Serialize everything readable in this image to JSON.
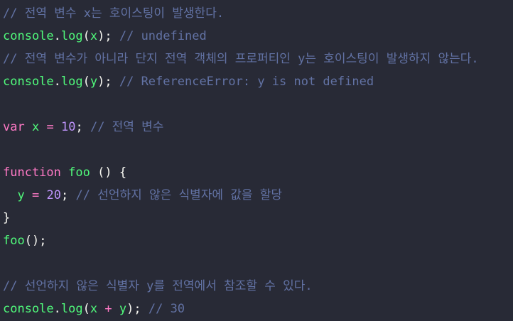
{
  "code": {
    "lines": [
      {
        "comment": "// 전역 변수 x는 호이스팅이 발생한다."
      },
      {
        "obj": "console",
        "dot": ".",
        "method": "log",
        "open": "(",
        "arg": "x",
        "close": ");",
        "space": " ",
        "comment": "// undefined"
      },
      {
        "comment": "// 전역 변수가 아니라 단지 전역 객체의 프로퍼티인 y는 호이스팅이 발생하지 않는다."
      },
      {
        "obj": "console",
        "dot": ".",
        "method": "log",
        "open": "(",
        "arg": "y",
        "close": ");",
        "space": " ",
        "comment": "// ReferenceError: y is not defined"
      },
      {},
      {
        "kw": "var",
        "s1": " ",
        "name": "x",
        "s2": " ",
        "op": "=",
        "s3": " ",
        "num": "10",
        "semi": ";",
        "s4": " ",
        "comment": "// 전역 변수"
      },
      {},
      {
        "kw": "function",
        "s1": " ",
        "name": "foo",
        "s2": " ",
        "parens": "()",
        "s3": " ",
        "brace": "{"
      },
      {
        "indent": "  ",
        "name": "y",
        "s1": " ",
        "op": "=",
        "s2": " ",
        "num": "20",
        "semi": ";",
        "s3": " ",
        "comment": "// 선언하지 않은 식별자에 값을 할당"
      },
      {
        "brace": "}"
      },
      {
        "name": "foo",
        "rest": "();"
      },
      {},
      {
        "comment": "// 선언하지 않은 식별자 y를 전역에서 참조할 수 있다."
      },
      {
        "obj": "console",
        "dot": ".",
        "method": "log",
        "open": "(",
        "a": "x",
        "s1": " ",
        "op": "+",
        "s2": " ",
        "b": "y",
        "close": ");",
        "space": " ",
        "comment": "// 30"
      }
    ]
  },
  "colors": {
    "background": "#282a36",
    "comment": "#6272a4",
    "identifier": "#50fa7b",
    "keyword": "#ff79c6",
    "number": "#bd93f9",
    "punctuation": "#f8f8f2"
  }
}
